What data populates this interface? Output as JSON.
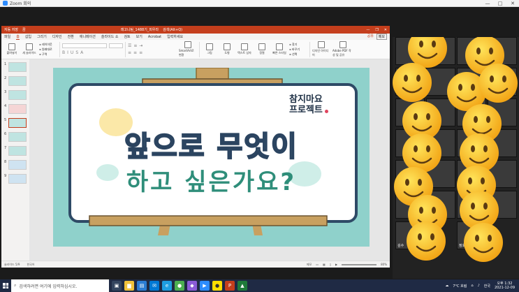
{
  "zoom": {
    "title": "Zoom 회의",
    "window_controls": [
      "—",
      "□",
      "✕"
    ]
  },
  "ppt": {
    "title_bar": {
      "autosave": "자동 저장",
      "autosave_state": "끔",
      "filename": "래고니팀_1488기_피우라",
      "search": "검색(Alt+Q)"
    },
    "tabs": [
      "파일",
      "홈",
      "삽입",
      "그리기",
      "디자인",
      "전환",
      "애니메이션",
      "슬라이드 쇼",
      "검토",
      "보기",
      "Acrobat",
      "입력하세요"
    ],
    "active_tab": "홈",
    "share": "공유",
    "comment": "메모",
    "ribbon": {
      "paste": "붙여넣기",
      "new_slide": "새 슬라이드",
      "layout": [
        "레이아웃",
        "원래대로",
        "구역"
      ],
      "smartart": "SmartArt로 변환",
      "picture": "그림",
      "shapes": "도형",
      "textbox": "텍스트 상자",
      "arrange": "정렬",
      "quick_styles": "빠른 스타일",
      "find_replace": [
        "찾기",
        "바꾸기",
        "선택"
      ],
      "designer": "디자인 아이디어",
      "acrobat": "Adobe PDF 작성 및 공유"
    },
    "slide_thumbs": [
      "1",
      "2",
      "3",
      "4",
      "5",
      "6",
      "7",
      "8",
      "9"
    ],
    "selected_slide": "5",
    "slide": {
      "badge_line1": "참지마요",
      "badge_line2": "프로젝트",
      "headline": "앞으로 무엇이",
      "subline": "하고 싶은가요?"
    },
    "status": {
      "slide_info": "슬라이드 5/9",
      "language": "한국어",
      "notes": "메모",
      "zoom": "80%"
    }
  },
  "gallery": {
    "names": [
      "김수",
      "정호"
    ]
  },
  "taskbar": {
    "search_placeholder": "검색하려면 여기에 입력하십시오.",
    "weather": "7°C 흐림",
    "ime": "한국",
    "time": "오후 1:32",
    "date": "2021-12-09"
  }
}
